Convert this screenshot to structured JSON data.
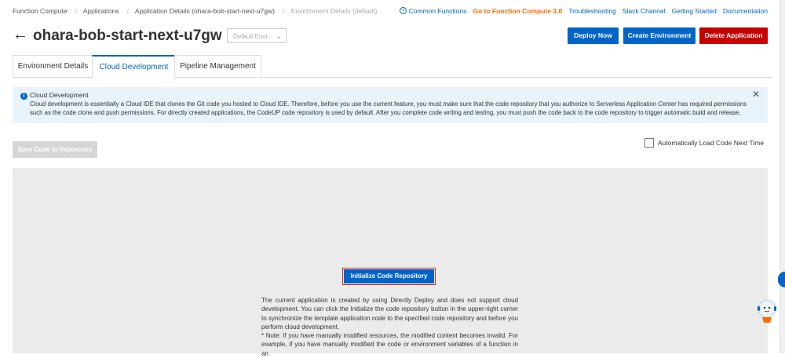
{
  "breadcrumb": [
    "Function Compute",
    "Applications",
    "Application Details (ohara-bob-start-next-u7gw)",
    "Environment Details (default)"
  ],
  "top_links": {
    "common_functions": "Common Functions",
    "go_fc3": "Go to Function Compute 3.0",
    "troubleshooting": "Troubleshooting",
    "slack": "Slack Channel",
    "getting_started": "Getting Started",
    "documentation": "Documentation"
  },
  "header": {
    "title": "ohara-bob-start-next-u7gw",
    "env_select": "Default Envi...",
    "deploy_now": "Deploy Now",
    "create_env": "Create Environment",
    "delete_app": "Delete Application"
  },
  "tabs": [
    "Environment Details",
    "Cloud Development",
    "Pipeline Management"
  ],
  "notice": {
    "title": "Cloud Development",
    "body": "Cloud development is essentially a Cloud IDE that clones the Git code you hosted to Cloud IDE. Therefore, before you use the current feature, you must make sure that the code repository that you authorize to Serverless Application Center has required permissions such as the code clone and push permissions. For directly created applications, the CodeUP code repository is used by default. After you complete code writing and testing, you must push the code back to the code repository to trigger automatic build and release."
  },
  "save_button": "Save Code to Repository",
  "auto_load": "Automatically Load Code Next Time",
  "init_button": "Initialize Code Repository",
  "description": {
    "p1": "The current application is created by using Directly Deploy and does not support cloud development. You can click the Initialize the code repository button in the upper-right corner to synchronize the template application code to the specified code repository and before you perform cloud development.",
    "p2": "* Note: If you have manually modified resources, the modified content becomes invalid. For example, if you have manually modified the code or environment variables of a function in an"
  },
  "colors": {
    "primary": "#0064c8",
    "danger": "#c80000",
    "accent": "#ff6a00",
    "notice_bg": "#e9f3fb"
  }
}
